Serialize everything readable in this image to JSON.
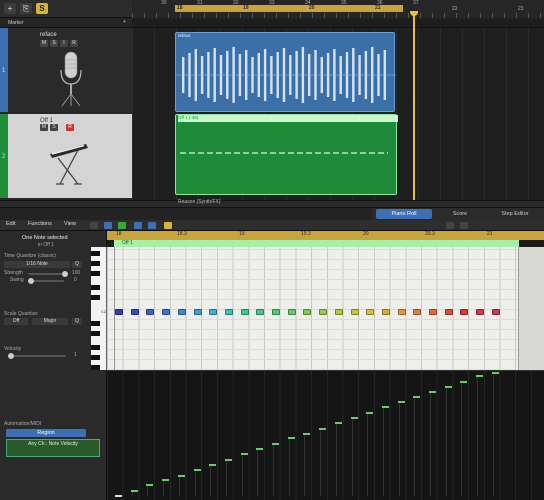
{
  "toolbar": {
    "buttons": [
      "+",
      "⎘",
      "S"
    ],
    "marker_label": "Marker",
    "marker_plus": "+"
  },
  "ruler_top": {
    "numbers": [
      "30",
      "31",
      "32",
      "33",
      "34",
      "35",
      "36",
      "37"
    ],
    "cycle_numbers": [
      "18",
      "19",
      "20",
      "21"
    ],
    "right_numbers": [
      "22",
      "23"
    ]
  },
  "tracks": [
    {
      "number": "1",
      "name": "reface",
      "buttons": [
        "M",
        "S",
        "I",
        "R"
      ],
      "color": "#3b6fb0"
    },
    {
      "number": "2",
      "name": "Off 1",
      "buttons": [
        "M",
        "S",
        "R"
      ],
      "color": "#1f8e3b"
    }
  ],
  "regions": {
    "audio_title": "reface",
    "midi_title": "Off 1 (-36)",
    "bottom_label": "Reason (Synth/FX)"
  },
  "editor_tabs": [
    "Piano Roll",
    "Score",
    "Step Editor"
  ],
  "editor_menus": [
    "Edit",
    "Functions",
    "View"
  ],
  "inspector": {
    "selection_title": "One Note selected",
    "selection_sub": "in Off 1",
    "time_quantize_label": "Time Quantize (classic)",
    "quantize_value": "1/16 Note",
    "q_button": "Q",
    "strength_label": "Strength",
    "strength_value": "100",
    "swing_label": "Swing",
    "swing_value": "0",
    "scale_quantize_label": "Scale Quantize",
    "scale_off": "Off",
    "scale_major": "Major",
    "velocity_label": "Velocity",
    "velocity_value": "1",
    "automation_label": "Automation/MIDI",
    "region_label": "Region",
    "note_velocity_label": "Any Ch.: Note Velocity"
  },
  "piano_roll": {
    "ruler_numbers": [
      "18",
      "18.3",
      "19",
      "19.3",
      "20",
      "20.3",
      "21"
    ],
    "region_name": "Off 1",
    "key_label": "C2",
    "note_colors": [
      "#3a3aa8",
      "#3a4bc4",
      "#3a5fd0",
      "#3a74d6",
      "#3a8ad6",
      "#3a9fd6",
      "#3ab4cc",
      "#3ac4b8",
      "#3ac8a0",
      "#3fc888",
      "#4fcc72",
      "#64cc5e",
      "#7ccc4e",
      "#94cc44",
      "#accc3e",
      "#c4c83a",
      "#d8c03a",
      "#e0aa3a",
      "#e6943a",
      "#e87c3a",
      "#e8643a",
      "#e44a3a",
      "#dc3a3a",
      "#d43a4a",
      "#d03a5a"
    ],
    "note_velocities": [
      1,
      6,
      12,
      17,
      22,
      28,
      33,
      38,
      44,
      49,
      54,
      60,
      65,
      70,
      76,
      81,
      86,
      92,
      97,
      102,
      108,
      113,
      118,
      124,
      127
    ]
  }
}
